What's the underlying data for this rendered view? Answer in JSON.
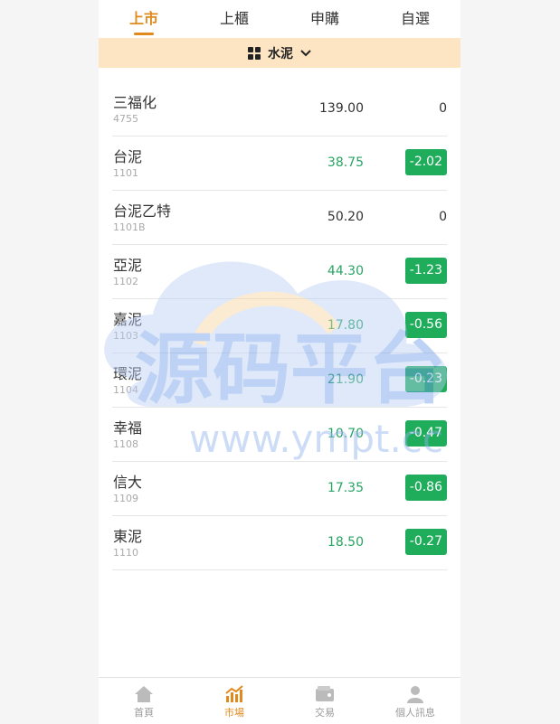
{
  "tabs": [
    {
      "label": "上市",
      "active": true
    },
    {
      "label": "上櫃",
      "active": false
    },
    {
      "label": "申購",
      "active": false
    },
    {
      "label": "自選",
      "active": false
    }
  ],
  "category": {
    "label": "水泥",
    "icon": "grid-icon",
    "dropdown_icon": "chevron-down-icon"
  },
  "stocks": [
    {
      "name": "三福化",
      "code": "4755",
      "price": "139.00",
      "change": "0",
      "direction": "flat"
    },
    {
      "name": "台泥",
      "code": "1101",
      "price": "38.75",
      "change": "-2.02",
      "direction": "down"
    },
    {
      "name": "台泥乙特",
      "code": "1101B",
      "price": "50.20",
      "change": "0",
      "direction": "flat"
    },
    {
      "name": "亞泥",
      "code": "1102",
      "price": "44.30",
      "change": "-1.23",
      "direction": "down"
    },
    {
      "name": "嘉泥",
      "code": "1103",
      "price": "17.80",
      "change": "-0.56",
      "direction": "down"
    },
    {
      "name": "環泥",
      "code": "1104",
      "price": "21.90",
      "change": "-0.23",
      "direction": "down"
    },
    {
      "name": "幸福",
      "code": "1108",
      "price": "10.70",
      "change": "-0.47",
      "direction": "down"
    },
    {
      "name": "信大",
      "code": "1109",
      "price": "17.35",
      "change": "-0.86",
      "direction": "down"
    },
    {
      "name": "東泥",
      "code": "1110",
      "price": "18.50",
      "change": "-0.27",
      "direction": "down"
    }
  ],
  "watermark": {
    "title": "源码平台",
    "url": "www.ympt.cc"
  },
  "nav": [
    {
      "label": "首頁",
      "icon": "home-icon",
      "active": false
    },
    {
      "label": "市場",
      "icon": "chart-icon",
      "active": true
    },
    {
      "label": "交易",
      "icon": "wallet-icon",
      "active": false
    },
    {
      "label": "個人訊息",
      "icon": "user-icon",
      "active": false
    }
  ],
  "colors": {
    "accent": "#e08a1e",
    "down": "#1fad5c",
    "category_bg": "#fde5c4"
  }
}
